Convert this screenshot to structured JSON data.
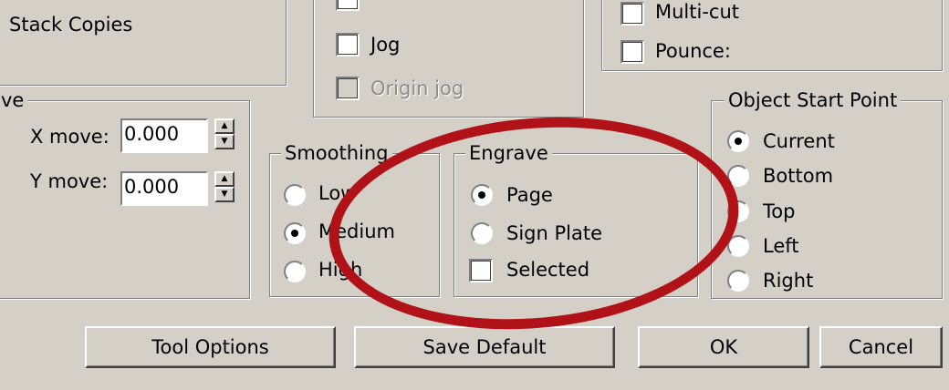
{
  "stack_copies": {
    "label": "Stack Copies"
  },
  "jog_group": {
    "items": [
      {
        "label": "Jog",
        "checked": false,
        "enabled": true
      },
      {
        "label": "Origin jog",
        "checked": false,
        "enabled": false
      }
    ]
  },
  "cut_options": {
    "items": [
      {
        "label": "Multi-cut",
        "checked": false
      },
      {
        "label": "Pounce:",
        "checked": false
      }
    ]
  },
  "move_group": {
    "title": "ve",
    "x_label": "X move:",
    "x_value": "0.000",
    "y_label": "Y move:",
    "y_value": "0.000"
  },
  "smoothing": {
    "title": "Smoothing",
    "options": [
      "Low",
      "Medium",
      "High"
    ],
    "selected": "Medium"
  },
  "engrave": {
    "title": "Engrave",
    "options": [
      "Page",
      "Sign Plate"
    ],
    "selected": "Page",
    "selected_checkbox_label": "Selected",
    "selected_checked": false
  },
  "object_start_point": {
    "title": "Object Start Point",
    "options": [
      "Current",
      "Bottom",
      "Top",
      "Left",
      "Right"
    ],
    "selected": "Current"
  },
  "buttons": {
    "tool_options": "Tool Options",
    "save_default": "Save Default",
    "ok": "OK",
    "cancel": "Cancel"
  },
  "colors": {
    "face": "#d4d0c8",
    "annotation": "#b01217"
  }
}
